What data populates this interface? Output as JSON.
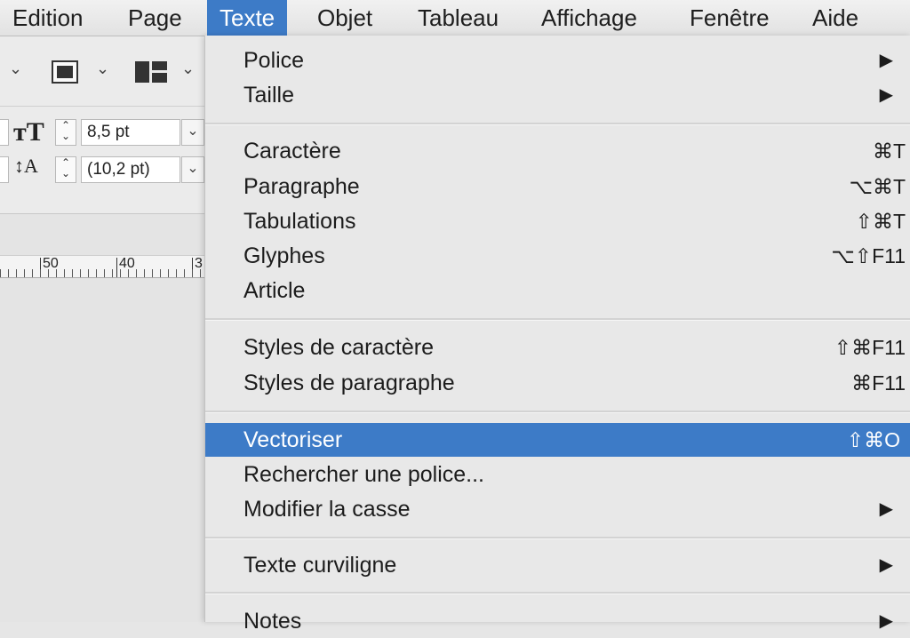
{
  "menubar": {
    "items": [
      "Edition",
      "Page",
      "Texte",
      "Objet",
      "Tableau",
      "Affichage",
      "Fenêtre",
      "Aide"
    ]
  },
  "toolbar": {
    "font_size_value": "8,5 pt",
    "leading_value": "(10,2 pt)",
    "ruler_labels": [
      "50",
      "40",
      "3"
    ]
  },
  "menu": {
    "police": {
      "label": "Police"
    },
    "taille": {
      "label": "Taille"
    },
    "caractere": {
      "label": "Caractère",
      "shortcut": "⌘T"
    },
    "paragraphe": {
      "label": "Paragraphe",
      "shortcut": "⌥⌘T"
    },
    "tabulations": {
      "label": "Tabulations",
      "shortcut": "⇧⌘T"
    },
    "glyphes": {
      "label": "Glyphes",
      "shortcut": "⌥⇧F11"
    },
    "article": {
      "label": "Article"
    },
    "styles_caractere": {
      "label": "Styles de caractère",
      "shortcut": "⇧⌘F11"
    },
    "styles_paragraphe": {
      "label": "Styles de paragraphe",
      "shortcut": "⌘F11"
    },
    "vectoriser": {
      "label": "Vectoriser",
      "shortcut": "⇧⌘O"
    },
    "rechercher": {
      "label": "Rechercher une police..."
    },
    "modifier_casse": {
      "label": "Modifier la casse"
    },
    "texte_curviligne": {
      "label": "Texte curviligne"
    },
    "notes": {
      "label": "Notes"
    }
  },
  "colors": {
    "highlight": "#3d7bc7",
    "menu_bg": "#e8e8e8"
  }
}
